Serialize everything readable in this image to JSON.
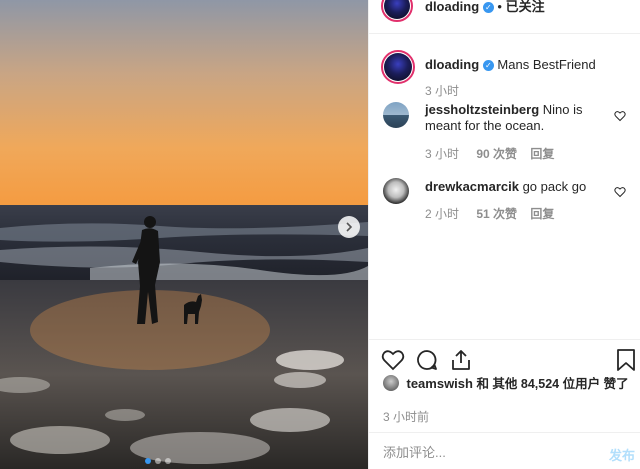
{
  "post": {
    "author": "dloading",
    "follow_label": "已关注",
    "separator": "•",
    "caption": "Mans BestFriend",
    "caption_time": "3 小时",
    "likes_user": "teamswish",
    "likes_text": "和 其他 84,524 位用户 赞了",
    "post_time": "3 小时前"
  },
  "comments": [
    {
      "user": "jessholtzsteinberg",
      "text": "Nino is meant for the ocean.",
      "time": "3 小时",
      "likes": "90 次赞",
      "reply": "回复"
    },
    {
      "user": "drewkacmarcik",
      "text": "go pack go",
      "time": "2 小时",
      "likes": "51 次赞",
      "reply": "回复"
    }
  ],
  "comment_box": {
    "placeholder": "添加评论...",
    "post_label": "发布"
  },
  "icons": {
    "verified": "verified-badge-icon",
    "next": "chevron-right-icon",
    "like": "heart-icon",
    "comment": "comment-bubble-icon",
    "share": "share-icon",
    "save": "bookmark-icon"
  },
  "colors": {
    "accent": "#3897f0",
    "story_ring": "#e1306c",
    "muted": "#8e8e8e"
  }
}
